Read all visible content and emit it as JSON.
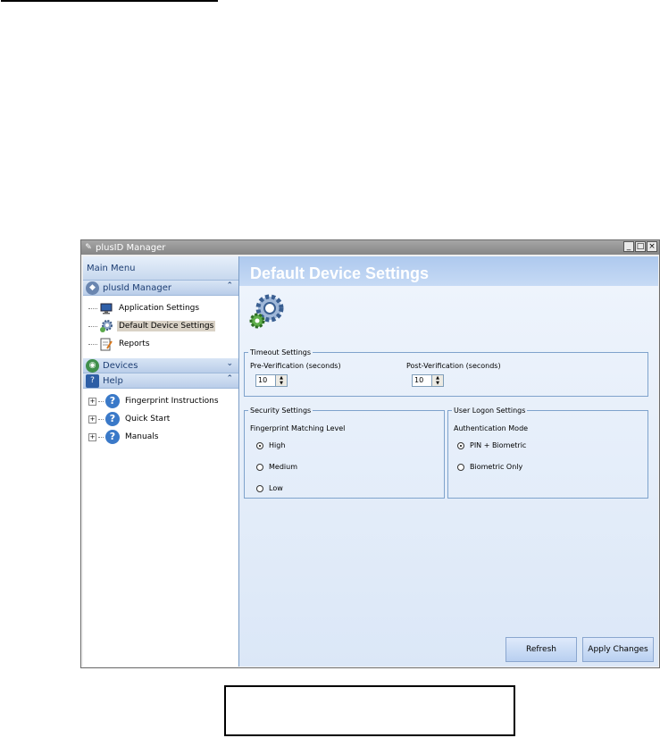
{
  "window": {
    "title": "plusID Manager",
    "minimize_glyph": "_",
    "maximize_glyph": "□",
    "close_glyph": "×"
  },
  "sidebar": {
    "main_menu": "Main Menu",
    "groups": [
      {
        "label": "plusId Manager",
        "icon": "plusid-shield-icon",
        "items": [
          {
            "label": "Application Settings",
            "icon": "monitor-icon"
          },
          {
            "label": "Default Device Settings",
            "icon": "gear-icon",
            "selected": true
          },
          {
            "label": "Reports",
            "icon": "report-icon"
          }
        ]
      },
      {
        "label": "Devices",
        "icon": "devices-globe-icon"
      },
      {
        "label": "Help",
        "icon": "help-book-icon",
        "items": [
          {
            "label": "Fingerprint Instructions",
            "icon": "help-icon"
          },
          {
            "label": "Quick Start",
            "icon": "help-icon"
          },
          {
            "label": "Manuals",
            "icon": "help-icon"
          }
        ]
      }
    ]
  },
  "main": {
    "title": "Default Device Settings",
    "timeout": {
      "legend": "Timeout Settings",
      "pre_label": "Pre-Verification (seconds)",
      "pre_value": "10",
      "post_label": "Post-Verification (seconds)",
      "post_value": "10"
    },
    "security": {
      "legend": "Security Settings",
      "label": "Fingerprint Matching Level",
      "options": [
        "High",
        "Medium",
        "Low"
      ],
      "selected": "High"
    },
    "logon": {
      "legend": "User Logon Settings",
      "label": "Authentication Mode",
      "options": [
        "PIN + Biometric",
        "Biometric Only"
      ],
      "selected": "PIN + Biometric"
    },
    "buttons": {
      "refresh": "Refresh",
      "apply": "Apply Changes"
    }
  },
  "colors": {
    "accent": "#3a79c8",
    "header_band": "#aec9ee",
    "panel_border": "#7fa3cc"
  }
}
